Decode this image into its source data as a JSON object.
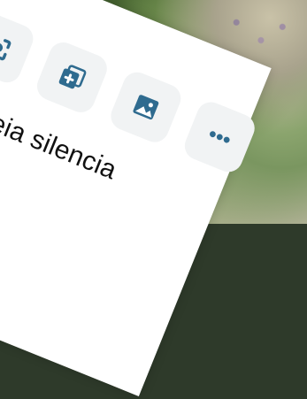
{
  "share_sheet": {
    "text": "le areia silencia",
    "actions": [
      {
        "icon": "focus-camera-icon"
      },
      {
        "icon": "copy-add-icon"
      },
      {
        "icon": "image-icon"
      },
      {
        "icon": "more-icon"
      }
    ]
  },
  "colors": {
    "icon": "#2f6b8f",
    "tile": "#f1f3f4",
    "sheet": "#ffffff",
    "text": "#111111"
  }
}
